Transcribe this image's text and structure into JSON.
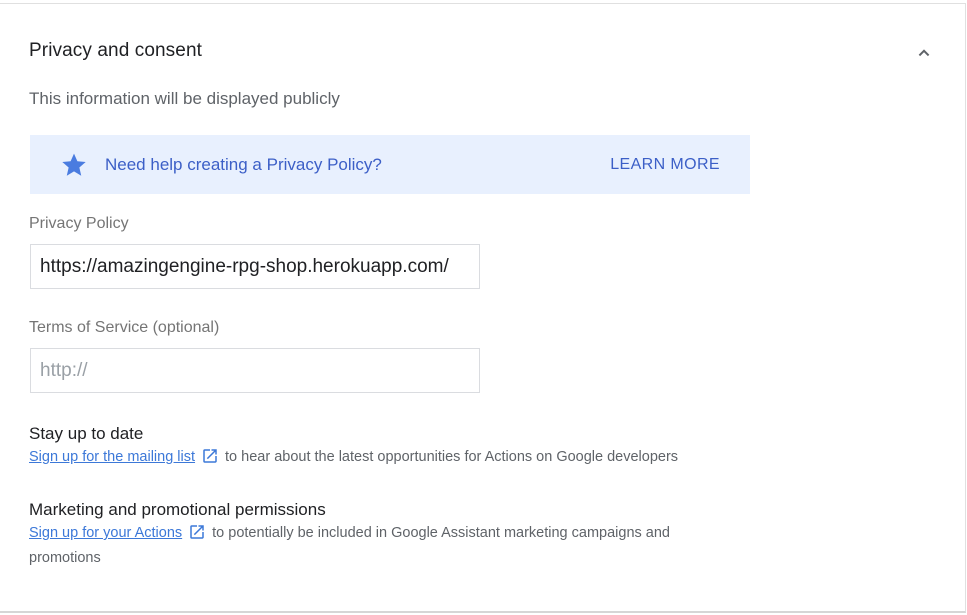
{
  "section": {
    "title": "Privacy and consent",
    "subtitle": "This information will be displayed publicly",
    "collapse_icon": "chevron-up-icon"
  },
  "banner": {
    "icon": "star-icon",
    "text": "Need help creating a Privacy Policy?",
    "action_label": "LEARN MORE",
    "background": "#e8f0fe",
    "accent": "#3c5fc7"
  },
  "privacy_policy": {
    "label": "Privacy Policy",
    "value": "https://amazingengine-rpg-shop.herokuapp.com/"
  },
  "terms_of_service": {
    "label": "Terms of Service (optional)",
    "value": "",
    "placeholder": "http://"
  },
  "stay_up_to_date": {
    "title": "Stay up to date",
    "link_text": "Sign up for the mailing list",
    "link_icon": "open-in-new-icon",
    "description": "to hear about the latest opportunities for Actions on Google developers"
  },
  "marketing": {
    "title": "Marketing and promotional permissions",
    "link_text": "Sign up for your Actions",
    "link_icon": "open-in-new-icon",
    "description": "to potentially be included in Google Assistant marketing campaigns and promotions"
  },
  "colors": {
    "link": "#3c78d8",
    "text_primary": "#202124",
    "text_secondary": "#5f6368"
  }
}
